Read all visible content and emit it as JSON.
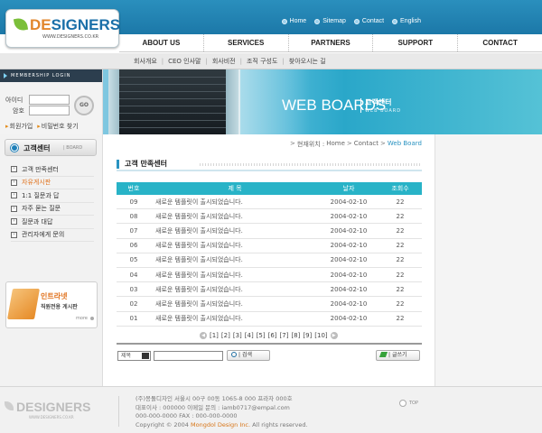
{
  "brand": {
    "logo_pre": "DE",
    "logo_post": "SIGNERS",
    "logo_sub": "WWW.DESIGNERS.CO.KR"
  },
  "top_links": [
    "Home",
    "Sitemap",
    "Contact",
    "English"
  ],
  "main_nav": [
    "ABOUT US",
    "SERVICES",
    "PARTNERS",
    "SUPPORT",
    "CONTACT"
  ],
  "sub_nav": [
    "회사개요",
    "CEO 인사말",
    "회사비전",
    "조직 구성도",
    "찾아오시는 길"
  ],
  "login": {
    "header": "MEMBERSHIP LOGIN",
    "id_label": "아이디",
    "pw_label": "암호",
    "go": "GO",
    "join": "회원가입",
    "find_pw": "비밀번호 찾기"
  },
  "hero": {
    "title": "WEB BOARDS",
    "kr": "고객센터",
    "en": "WEB BOARD"
  },
  "sidebar": {
    "title": "고객센터",
    "sub": "BOARD",
    "items": [
      {
        "label": "고객 만족센터"
      },
      {
        "label": "자유게시판"
      },
      {
        "label": "1:1 질문과 답"
      },
      {
        "label": "자주 묻는 질문"
      },
      {
        "label": "질문과 대답"
      },
      {
        "label": "관리자에게 문의"
      }
    ],
    "active_index": 1
  },
  "promo": {
    "title": "인트라넷",
    "subtitle": "직원전용 게시판",
    "more": "more"
  },
  "breadcrumb": {
    "label": "현재위치 :",
    "path": [
      "Home",
      "Contact"
    ],
    "current": "Web Board"
  },
  "content_title": "고객 만족센터",
  "table": {
    "headers": [
      "번호",
      "제 목",
      "날자",
      "조회수"
    ],
    "rows": [
      [
        "09",
        "새로운 템플릿이 출시되었습니다.",
        "2004-02-10",
        "22"
      ],
      [
        "08",
        "새로운 템플릿이 출시되었습니다.",
        "2004-02-10",
        "22"
      ],
      [
        "07",
        "새로운 템플릿이 출시되었습니다.",
        "2004-02-10",
        "22"
      ],
      [
        "06",
        "새로운 템플릿이 출시되었습니다.",
        "2004-02-10",
        "22"
      ],
      [
        "05",
        "새로운 템플릿이 출시되었습니다.",
        "2004-02-10",
        "22"
      ],
      [
        "04",
        "새로운 템플릿이 출시되었습니다.",
        "2004-02-10",
        "22"
      ],
      [
        "03",
        "새로운 템플릿이 출시되었습니다.",
        "2004-02-10",
        "22"
      ],
      [
        "02",
        "새로운 템플릿이 출시되었습니다.",
        "2004-02-10",
        "22"
      ],
      [
        "01",
        "새로운 템플릿이 출시되었습니다.",
        "2004-02-10",
        "22"
      ]
    ]
  },
  "pager": {
    "pages": [
      "[1]",
      "[2]",
      "[3]",
      "[4]",
      "[5]",
      "[6]",
      "[7]",
      "[8]",
      "[9]",
      "[10]"
    ]
  },
  "search": {
    "select_value": "제목",
    "button": "검색",
    "write_button": "글쓰기"
  },
  "footer": {
    "logo": "DESIGNERS",
    "logo_sub": "WWW.DESIGNERS.CO.KR",
    "line1": "(주)몽돌디자인 서울시 00구 00동 1065-8 000 프라자 000호",
    "line2": "대표이사 : 000000  이메일 문의 : iamb0717@empal.com",
    "line3": "000-000-0000   FAX : 000-000-0000",
    "copy_pre": "Copyright © 2004 ",
    "copy_brand": "Mongdol Design Inc.",
    "copy_post": " All rights reserved.",
    "top": "TOP"
  },
  "colors": {
    "header_blue": "#1c78a8",
    "table_header": "#28b3c7",
    "accent_orange": "#e0711b"
  }
}
